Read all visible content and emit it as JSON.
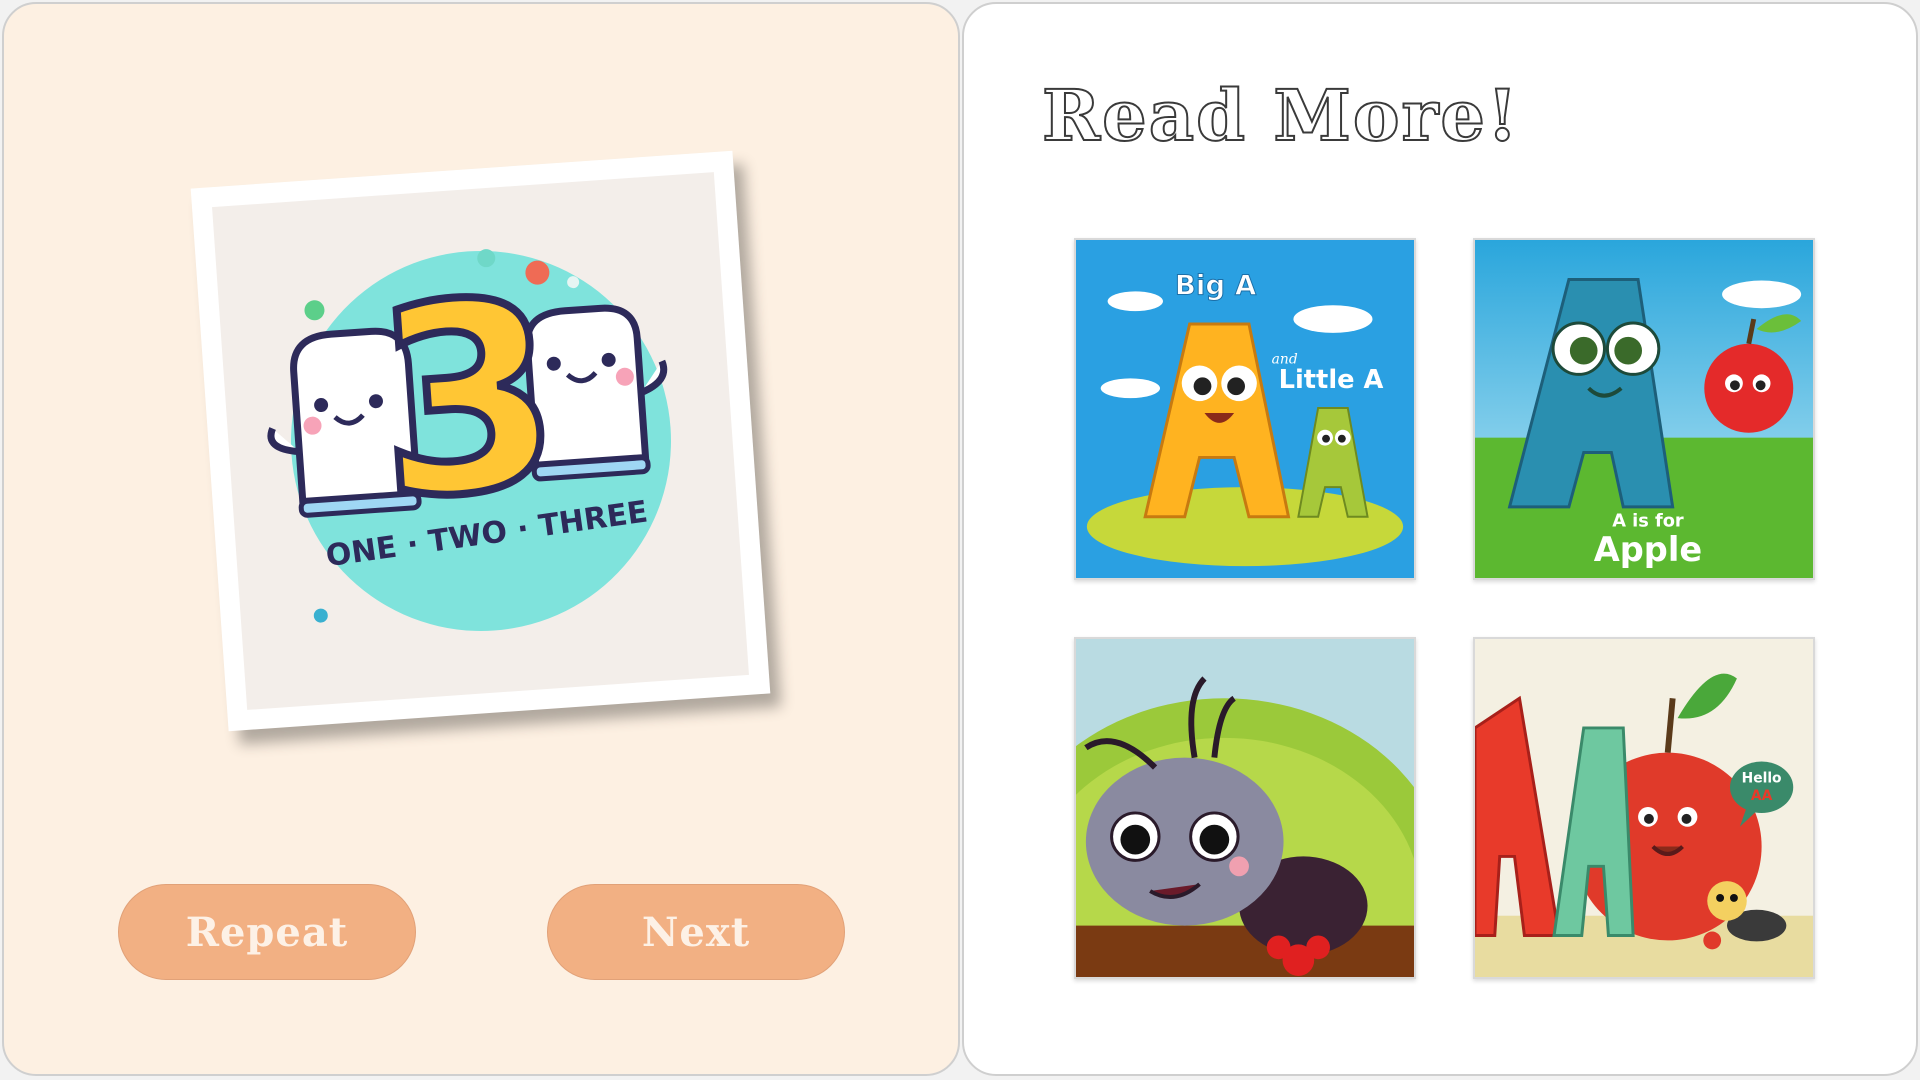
{
  "left_panel": {
    "card": {
      "big_number": "3",
      "caption": "ONE · TWO · THREE"
    },
    "buttons": {
      "repeat_label": "Repeat",
      "next_label": "Next"
    }
  },
  "right_panel": {
    "heading": "Read More!",
    "books": [
      {
        "title_line1": "Big A",
        "and_text": "and",
        "title_line2": "Little A"
      },
      {
        "subtitle": "A is for",
        "title": "Apple"
      },
      {},
      {
        "bubble_text": "Hello",
        "bubble_letters": "AA"
      }
    ]
  },
  "colors": {
    "left_bg": "#fdf0e2",
    "button_bg": "#f2b083",
    "button_text": "#fdf1e6",
    "right_bg": "#ffffff"
  }
}
